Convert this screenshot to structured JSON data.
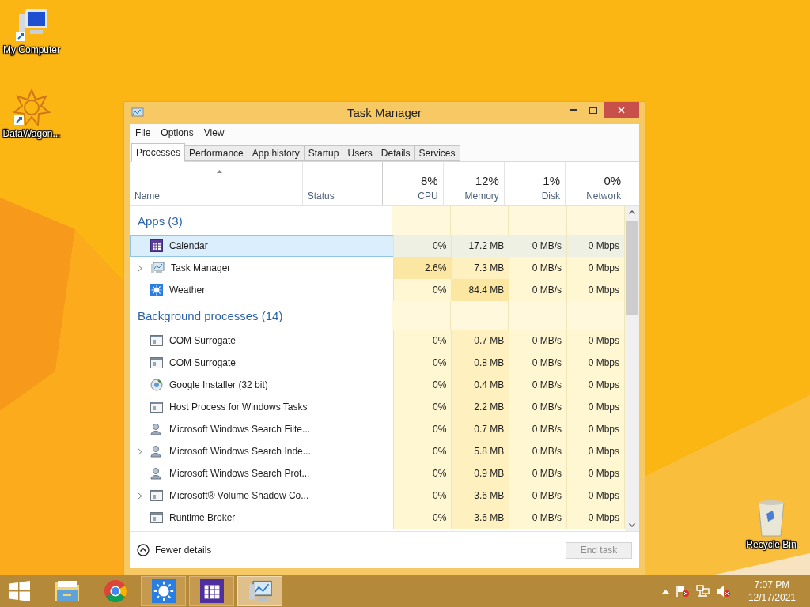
{
  "desktop_icons": [
    {
      "label": "My Computer"
    },
    {
      "label": "DataWagon..."
    },
    {
      "label": "Recycle Bin"
    }
  ],
  "window": {
    "title": "Task Manager"
  },
  "menu": [
    "File",
    "Options",
    "View"
  ],
  "tabs": [
    {
      "label": "Processes",
      "selected": true
    },
    {
      "label": "Performance",
      "selected": false
    },
    {
      "label": "App history",
      "selected": false
    },
    {
      "label": "Startup",
      "selected": false
    },
    {
      "label": "Users",
      "selected": false
    },
    {
      "label": "Details",
      "selected": false
    },
    {
      "label": "Services",
      "selected": false
    }
  ],
  "columns": [
    {
      "label": "Name"
    },
    {
      "label": "Status"
    },
    {
      "percent": "8%",
      "label": "CPU"
    },
    {
      "percent": "12%",
      "label": "Memory"
    },
    {
      "percent": "1%",
      "label": "Disk"
    },
    {
      "percent": "0%",
      "label": "Network"
    }
  ],
  "rows": [
    {
      "kind": "group",
      "label": "Apps (3)"
    },
    {
      "kind": "process",
      "name": "Calendar",
      "expandable": false,
      "selected": true,
      "cpu": "0%",
      "memory": "17.2 MB",
      "disk": "0 MB/s",
      "network": "0 Mbps"
    },
    {
      "kind": "process",
      "name": "Task Manager",
      "expandable": true,
      "selected": false,
      "cpu": "2.6%",
      "memory": "7.3 MB",
      "disk": "0 MB/s",
      "network": "0 Mbps"
    },
    {
      "kind": "process",
      "name": "Weather",
      "expandable": false,
      "selected": false,
      "cpu": "0%",
      "memory": "84.4 MB",
      "disk": "0 MB/s",
      "network": "0 Mbps"
    },
    {
      "kind": "group",
      "label": "Background processes (14)"
    },
    {
      "kind": "process",
      "name": "COM Surrogate",
      "expandable": false,
      "selected": false,
      "cpu": "0%",
      "memory": "0.7 MB",
      "disk": "0 MB/s",
      "network": "0 Mbps"
    },
    {
      "kind": "process",
      "name": "COM Surrogate",
      "expandable": false,
      "selected": false,
      "cpu": "0%",
      "memory": "0.8 MB",
      "disk": "0 MB/s",
      "network": "0 Mbps"
    },
    {
      "kind": "process",
      "name": "Google Installer (32 bit)",
      "expandable": false,
      "selected": false,
      "cpu": "0%",
      "memory": "0.4 MB",
      "disk": "0 MB/s",
      "network": "0 Mbps"
    },
    {
      "kind": "process",
      "name": "Host Process for Windows Tasks",
      "expandable": false,
      "selected": false,
      "cpu": "0%",
      "memory": "2.2 MB",
      "disk": "0 MB/s",
      "network": "0 Mbps"
    },
    {
      "kind": "process",
      "name": "Microsoft Windows Search Filte...",
      "expandable": false,
      "selected": false,
      "cpu": "0%",
      "memory": "0.7 MB",
      "disk": "0 MB/s",
      "network": "0 Mbps"
    },
    {
      "kind": "process",
      "name": "Microsoft Windows Search Inde...",
      "expandable": true,
      "selected": false,
      "cpu": "0%",
      "memory": "5.8 MB",
      "disk": "0 MB/s",
      "network": "0 Mbps"
    },
    {
      "kind": "process",
      "name": "Microsoft Windows Search Prot...",
      "expandable": false,
      "selected": false,
      "cpu": "0%",
      "memory": "0.9 MB",
      "disk": "0 MB/s",
      "network": "0 Mbps"
    },
    {
      "kind": "process",
      "name": "Microsoft® Volume Shadow Co...",
      "expandable": true,
      "selected": false,
      "cpu": "0%",
      "memory": "3.6 MB",
      "disk": "0 MB/s",
      "network": "0 Mbps"
    },
    {
      "kind": "process",
      "name": "Runtime Broker",
      "expandable": false,
      "selected": false,
      "cpu": "0%",
      "memory": "3.6 MB",
      "disk": "0 MB/s",
      "network": "0 Mbps"
    }
  ],
  "footer": {
    "details_link": "Fewer details",
    "end_task": {
      "label": "End task",
      "disabled": true
    }
  },
  "taskbar": [
    {
      "running": false,
      "selected": false
    },
    {
      "running": false,
      "selected": false
    },
    {
      "running": false,
      "selected": false
    },
    {
      "running": true,
      "selected": false
    },
    {
      "running": true,
      "selected": false
    },
    {
      "running": true,
      "selected": true
    }
  ],
  "tray": {
    "time": "7:07 PM",
    "date": "12/17/2021"
  }
}
